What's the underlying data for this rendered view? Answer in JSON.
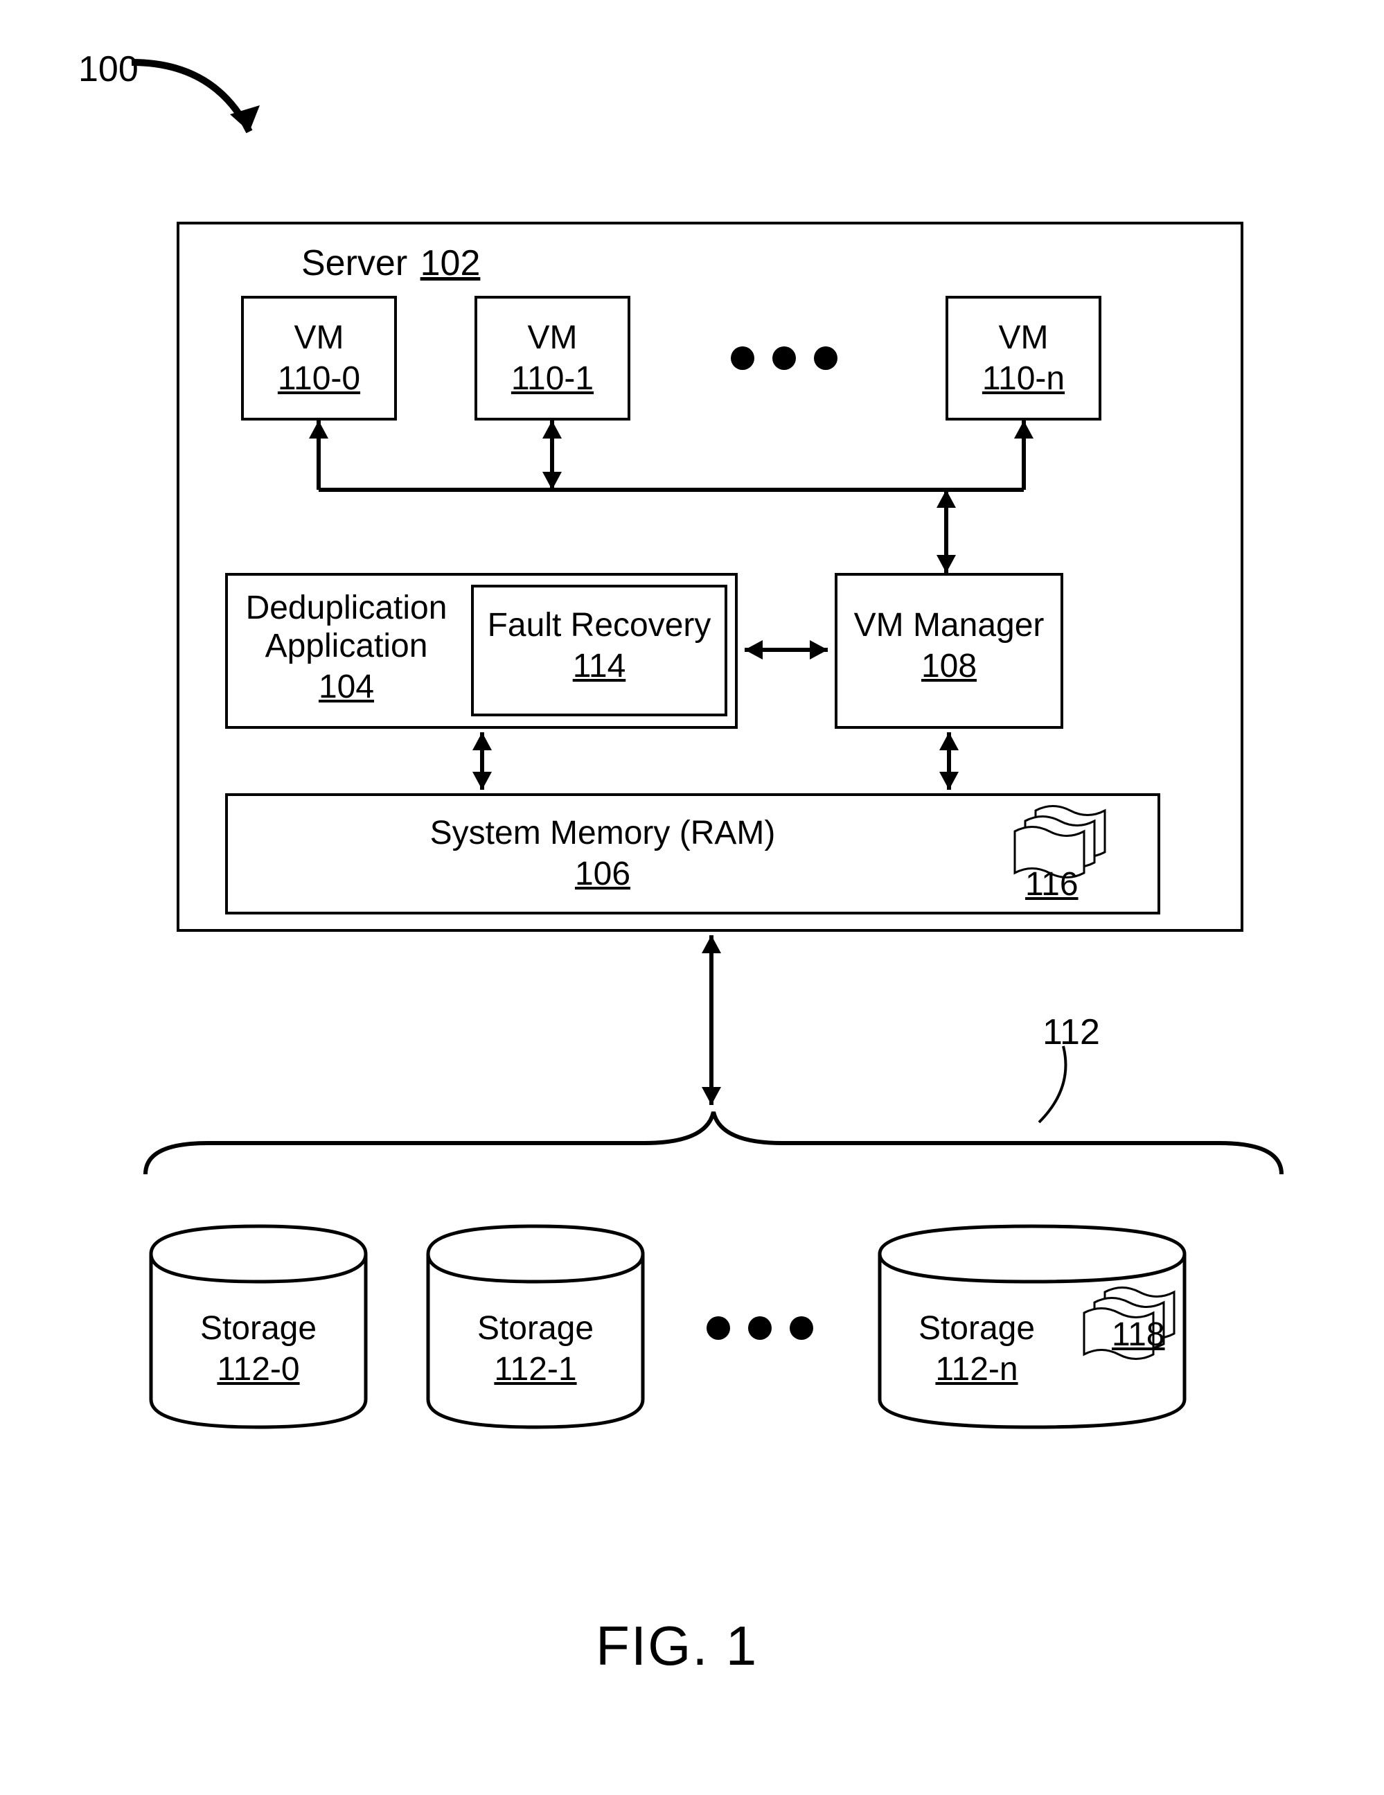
{
  "figureRef": "100",
  "figureCaption": "FIG.  1",
  "server": {
    "label": "Server",
    "ref": "102"
  },
  "vm0": {
    "label": "VM",
    "ref": "110-0"
  },
  "vm1": {
    "label": "VM",
    "ref": "110-1"
  },
  "vmn": {
    "label": "VM",
    "ref": "110-n"
  },
  "dedup": {
    "label1": "Deduplication",
    "label2": "Application",
    "ref": "104"
  },
  "fault": {
    "label": "Fault Recovery",
    "ref": "114"
  },
  "vmmgr": {
    "label": "VM Manager",
    "ref": "108"
  },
  "ram": {
    "label": "System Memory (RAM)",
    "ref": "106"
  },
  "ramDocs": {
    "ref": "116"
  },
  "storageGroup": {
    "ref": "112"
  },
  "stor0": {
    "label": "Storage",
    "ref": "112-0"
  },
  "stor1": {
    "label": "Storage",
    "ref": "112-1"
  },
  "storn": {
    "label": "Storage",
    "ref": "112-n"
  },
  "storDocs": {
    "ref": "118"
  }
}
